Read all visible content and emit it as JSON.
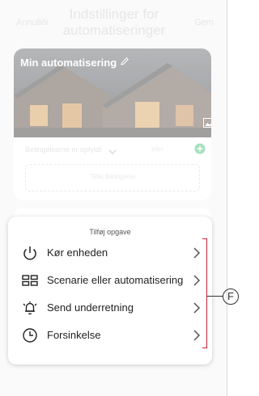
{
  "header": {
    "cancel_label": "Annullér",
    "title": "Indstillinger for automatiseringer",
    "save_label": "Gem"
  },
  "hero": {
    "name": "Min automatisering"
  },
  "conditions": {
    "label": "Betingelserne er opfyldt",
    "either_label": "eller",
    "add_label": "Tilføj Betingelse"
  },
  "task_sheet": {
    "title": "Tilføj opgave",
    "items": [
      {
        "label": "Kør enheden",
        "icon": "power-icon"
      },
      {
        "label": "Scenarie eller automatisering",
        "icon": "scene-grid-icon"
      },
      {
        "label": "Send underretning",
        "icon": "bell-icon"
      },
      {
        "label": "Forsinkelse",
        "icon": "clock-icon"
      }
    ]
  },
  "annotation": {
    "callout_letter": "F",
    "bracket_color": "#c7203a"
  },
  "colors": {
    "accent_green": "#3dbb73",
    "header_text": "#c9c9cf"
  }
}
